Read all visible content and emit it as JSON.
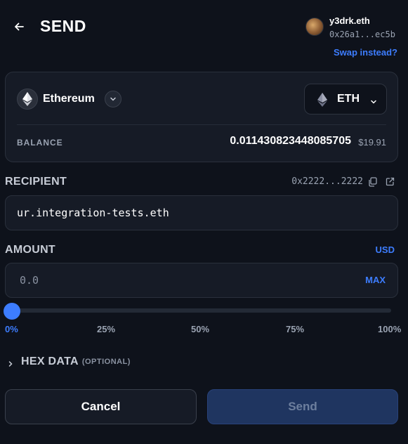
{
  "header": {
    "title": "SEND",
    "account_name": "y3drk.eth",
    "account_address": "0x26a1...ec5b",
    "swap_link": "Swap instead?"
  },
  "token": {
    "chain_name": "Ethereum",
    "asset_symbol": "ETH",
    "balance_label": "BALANCE",
    "balance_value": "0.011430823448085705",
    "balance_usd": "$19.91"
  },
  "recipient": {
    "label": "RECIPIENT",
    "resolved_address": "0x2222...2222",
    "input_value": "ur.integration-tests.eth"
  },
  "amount": {
    "label": "AMOUNT",
    "currency_toggle": "USD",
    "placeholder": "0.0",
    "max_label": "MAX",
    "slider_value_percent": 0,
    "ticks": [
      "0%",
      "25%",
      "50%",
      "75%",
      "100%"
    ]
  },
  "hex_data": {
    "label": "HEX DATA",
    "optional": "(OPTIONAL)"
  },
  "actions": {
    "cancel": "Cancel",
    "send": "Send"
  },
  "colors": {
    "accent": "#3d7dff",
    "background": "#0e121b",
    "card": "#161b26",
    "send_disabled": "#1f3560"
  }
}
